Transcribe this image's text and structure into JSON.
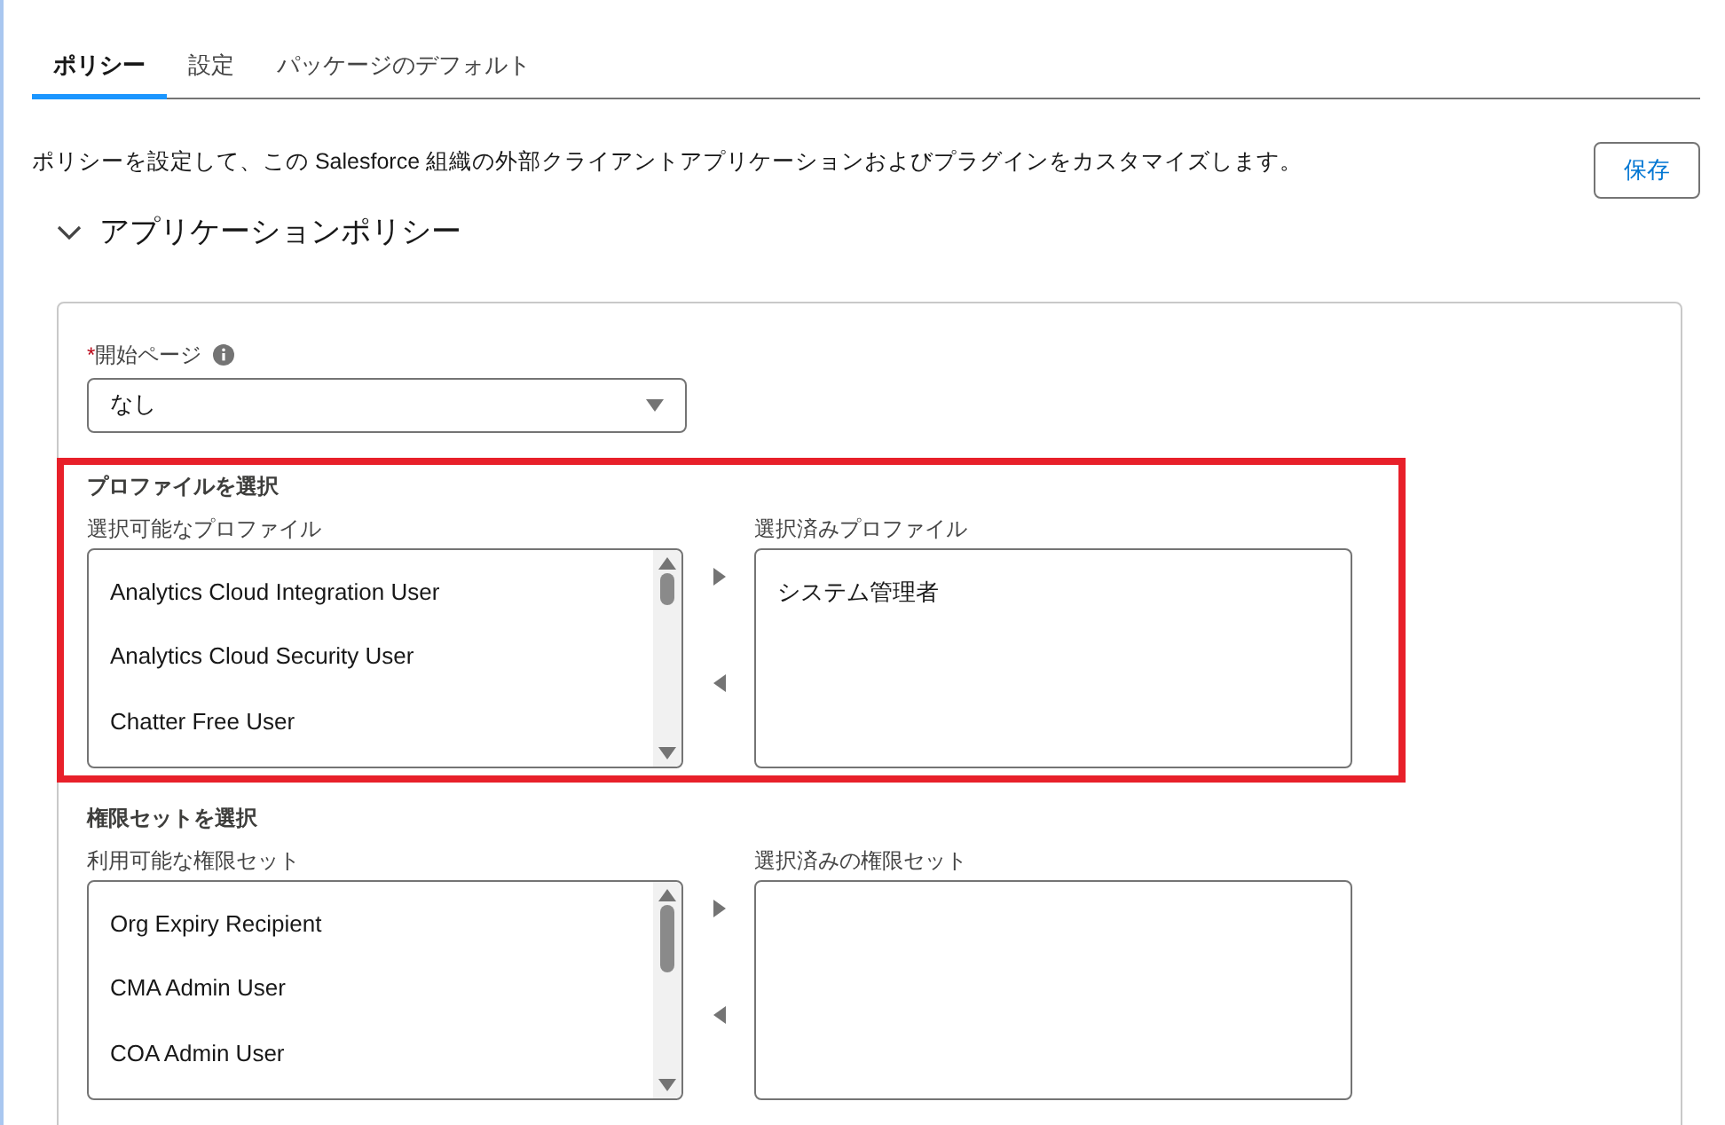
{
  "tabs": [
    {
      "label": "ポリシー",
      "selected": true
    },
    {
      "label": "設定",
      "selected": false
    },
    {
      "label": "パッケージのデフォルト",
      "selected": false
    }
  ],
  "description": "ポリシーを設定して、この Salesforce 組織の外部クライアントアプリケーションおよびプラグインをカスタマイズします。",
  "save_button": "保存",
  "section": {
    "title": "アプリケーションポリシー",
    "expanded": true
  },
  "start_page": {
    "label": "開始ページ",
    "required_mark": "*",
    "value": "なし"
  },
  "profiles": {
    "title": "プロファイルを選択",
    "highlighted": true,
    "available_label": "選択可能なプロファイル",
    "available": [
      "Analytics Cloud Integration User",
      "Analytics Cloud Security User",
      "Chatter Free User"
    ],
    "selected_label": "選択済みプロファイル",
    "selected": [
      "システム管理者"
    ]
  },
  "permission_sets": {
    "title": "権限セットを選択",
    "available_label": "利用可能な権限セット",
    "available": [
      "Org Expiry Recipient",
      "CMA Admin User",
      "COA Admin User"
    ],
    "selected_label": "選択済みの権限セット"
  }
}
